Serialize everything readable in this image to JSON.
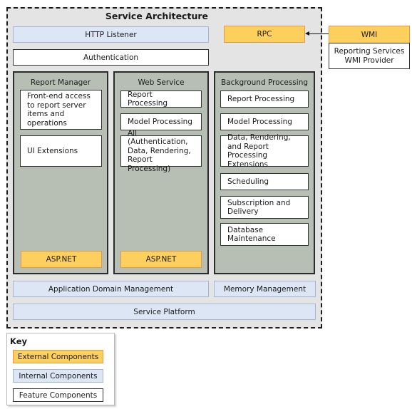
{
  "title": "Service Architecture",
  "top": {
    "http_listener": "HTTP Listener",
    "authentication": "Authentication",
    "rpc": "RPC",
    "wmi": "WMI",
    "wmi_provider": "Reporting Services\nWMI Provider"
  },
  "columns": {
    "report_manager": {
      "title": "Report Manager",
      "items": [
        "Front-end access to report server items and operations",
        "UI Extensions"
      ],
      "footer": "ASP.NET"
    },
    "web_service": {
      "title": "Web Service",
      "items": [
        "Report Processing",
        "Model Processing",
        "All (Authentication, Data, Rendering, Report Processing)"
      ],
      "footer": "ASP.NET"
    },
    "background_processing": {
      "title": "Background Processing",
      "items": [
        "Report Processing",
        "Model Processing",
        "Data, Rendering, and Report Processing Extensions",
        "Scheduling",
        "Subscription and Delivery",
        "Database Maintenance"
      ]
    }
  },
  "bottom": {
    "app_domain": "Application Domain Management",
    "memory": "Memory Management",
    "service_platform": "Service Platform"
  },
  "key": {
    "title": "Key",
    "external": "External Components",
    "internal": "Internal Components",
    "feature": "Feature Components"
  },
  "colors": {
    "external": "#fdcf5c",
    "internal": "#dde6f4",
    "feature": "#ffffff",
    "column": "#b7bfb4",
    "service_bg": "#e4e4e4"
  }
}
